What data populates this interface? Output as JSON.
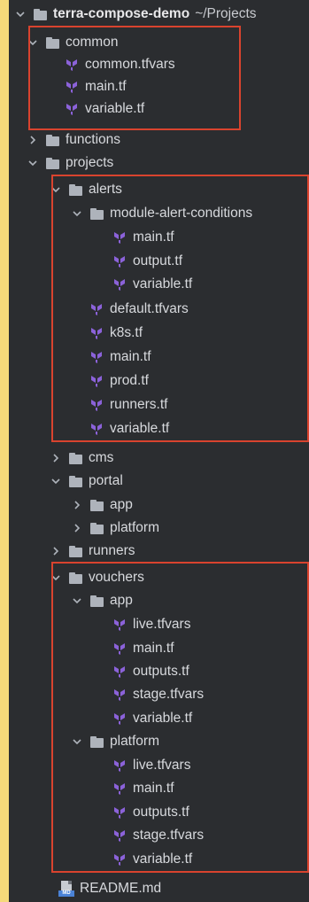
{
  "root": {
    "name": "terra-compose-demo",
    "path": "~/Projects"
  },
  "tree": {
    "common": "common",
    "common_tfvars": "common.tfvars",
    "common_main": "main.tf",
    "common_variable": "variable.tf",
    "functions": "functions",
    "projects": "projects",
    "alerts": "alerts",
    "module_alert_conditions": "module-alert-conditions",
    "mac_main": "main.tf",
    "mac_output": "output.tf",
    "mac_variable": "variable.tf",
    "alerts_default": "default.tfvars",
    "alerts_k8s": "k8s.tf",
    "alerts_main": "main.tf",
    "alerts_prod": "prod.tf",
    "alerts_runners": "runners.tf",
    "alerts_variable": "variable.tf",
    "cms": "cms",
    "portal": "portal",
    "portal_app": "app",
    "portal_platform": "platform",
    "runners": "runners",
    "vouchers": "vouchers",
    "vouchers_app": "app",
    "va_live": "live.tfvars",
    "va_main": "main.tf",
    "va_outputs": "outputs.tf",
    "va_stage": "stage.tfvars",
    "va_variable": "variable.tf",
    "vouchers_platform": "platform",
    "vp_live": "live.tfvars",
    "vp_main": "main.tf",
    "vp_outputs": "outputs.tf",
    "vp_stage": "stage.tfvars",
    "vp_variable": "variable.tf",
    "readme": "README.md"
  },
  "icons": {
    "folder": "folder-icon",
    "terraform": "terraform-file-icon",
    "markdown": "markdown-file-icon",
    "expanded": "chevron-down-icon",
    "collapsed": "chevron-right-icon"
  },
  "colors": {
    "panel_background": "#2b2d30",
    "page_background": "#f5d97a",
    "highlight_border": "#d9432e",
    "terraform_purple": "#8b62d9",
    "markdown_badge": "#4a82d6"
  }
}
